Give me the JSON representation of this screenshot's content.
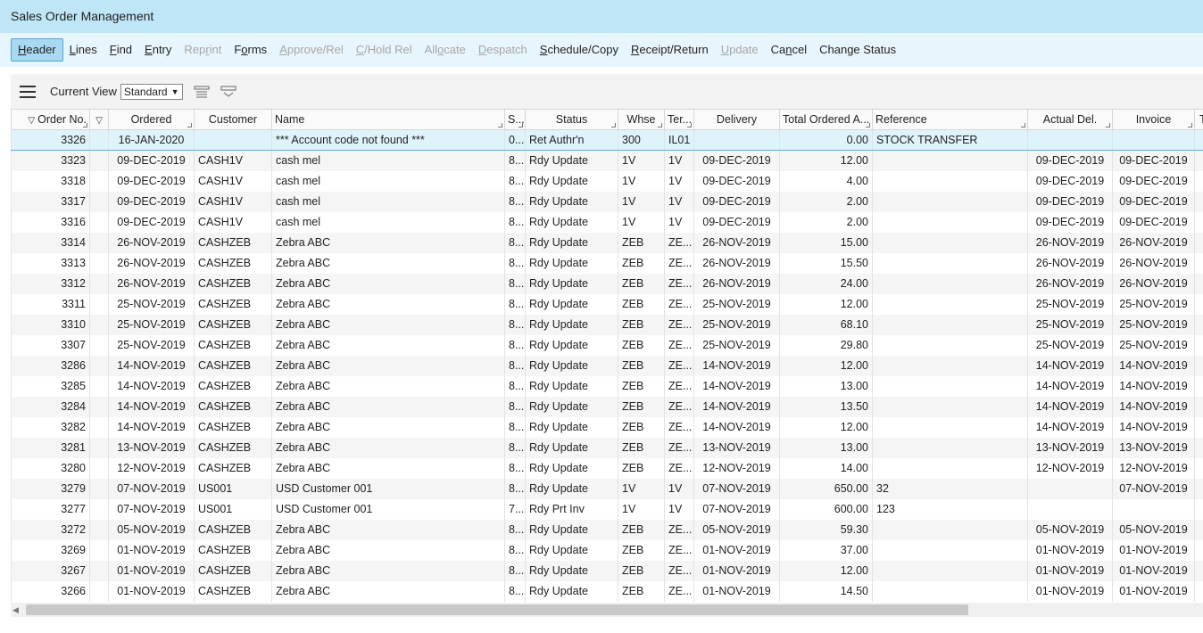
{
  "window": {
    "title": "Sales Order Management"
  },
  "menu": [
    {
      "pre": "",
      "u": "H",
      "post": "eader",
      "state": "active"
    },
    {
      "pre": "",
      "u": "L",
      "post": "ines",
      "state": "enabled"
    },
    {
      "pre": "",
      "u": "F",
      "post": "ind",
      "state": "enabled"
    },
    {
      "pre": "",
      "u": "E",
      "post": "ntry",
      "state": "enabled"
    },
    {
      "pre": "Rep",
      "u": "r",
      "post": "int",
      "state": "disabled"
    },
    {
      "pre": "F",
      "u": "o",
      "post": "rms",
      "state": "enabled"
    },
    {
      "pre": "",
      "u": "A",
      "post": "pprove/Rel",
      "state": "disabled"
    },
    {
      "pre": "",
      "u": "C",
      "post": "/Hold Rel",
      "state": "disabled"
    },
    {
      "pre": "All",
      "u": "o",
      "post": "cate",
      "state": "disabled"
    },
    {
      "pre": "",
      "u": "D",
      "post": "espatch",
      "state": "disabled"
    },
    {
      "pre": "",
      "u": "S",
      "post": "chedule/Copy",
      "state": "enabled"
    },
    {
      "pre": "",
      "u": "R",
      "post": "eceipt/Return",
      "state": "enabled"
    },
    {
      "pre": "",
      "u": "U",
      "post": "pdate",
      "state": "disabled"
    },
    {
      "pre": "Ca",
      "u": "n",
      "post": "cel",
      "state": "enabled"
    },
    {
      "pre": "Change Status",
      "u": "",
      "post": "",
      "state": "enabled"
    }
  ],
  "toolbar": {
    "view_label": "Current View",
    "view_value": "Standard",
    "icons": [
      "menu-icon",
      "filter-rows-icon",
      "collapse-panel-icon"
    ]
  },
  "columns": [
    {
      "label": "Order No.",
      "w": 88
    },
    {
      "label": "",
      "w": 21
    },
    {
      "label": "Ordered",
      "w": 96
    },
    {
      "label": "Customer",
      "w": 87
    },
    {
      "label": "Name",
      "w": 261
    },
    {
      "label": "S...",
      "w": 23
    },
    {
      "label": "Status",
      "w": 104
    },
    {
      "label": "Whse",
      "w": 52
    },
    {
      "label": "Ter...",
      "w": 33
    },
    {
      "label": "Delivery",
      "w": 96
    },
    {
      "label": "Total Ordered A...",
      "w": 104
    },
    {
      "label": "Reference",
      "w": 174
    },
    {
      "label": "Actual Del.",
      "w": 95
    },
    {
      "label": "Invoice",
      "w": 92
    },
    {
      "label": "T",
      "w": 19
    }
  ],
  "rows": [
    [
      "3326",
      "",
      "16-JAN-2020",
      "",
      "*** Account code not found ***",
      "0...",
      "Ret Authr'n",
      "300",
      "IL01",
      "",
      "0.00",
      "STOCK TRANSFER",
      "",
      "",
      ""
    ],
    [
      "3323",
      "",
      "09-DEC-2019",
      "CASH1V",
      "cash mel",
      "8...",
      "Rdy Update",
      "1V",
      "1V",
      "09-DEC-2019",
      "12.00",
      "",
      "09-DEC-2019",
      "09-DEC-2019",
      ""
    ],
    [
      "3318",
      "",
      "09-DEC-2019",
      "CASH1V",
      "cash mel",
      "8...",
      "Rdy Update",
      "1V",
      "1V",
      "09-DEC-2019",
      "4.00",
      "",
      "09-DEC-2019",
      "09-DEC-2019",
      ""
    ],
    [
      "3317",
      "",
      "09-DEC-2019",
      "CASH1V",
      "cash mel",
      "8...",
      "Rdy Update",
      "1V",
      "1V",
      "09-DEC-2019",
      "2.00",
      "",
      "09-DEC-2019",
      "09-DEC-2019",
      ""
    ],
    [
      "3316",
      "",
      "09-DEC-2019",
      "CASH1V",
      "cash mel",
      "8...",
      "Rdy Update",
      "1V",
      "1V",
      "09-DEC-2019",
      "2.00",
      "",
      "09-DEC-2019",
      "09-DEC-2019",
      ""
    ],
    [
      "3314",
      "",
      "26-NOV-2019",
      "CASHZEB",
      "Zebra ABC",
      "8...",
      "Rdy Update",
      "ZEB",
      "ZE...",
      "26-NOV-2019",
      "15.00",
      "",
      "26-NOV-2019",
      "26-NOV-2019",
      ""
    ],
    [
      "3313",
      "",
      "26-NOV-2019",
      "CASHZEB",
      "Zebra ABC",
      "8...",
      "Rdy Update",
      "ZEB",
      "ZE...",
      "26-NOV-2019",
      "15.50",
      "",
      "26-NOV-2019",
      "26-NOV-2019",
      ""
    ],
    [
      "3312",
      "",
      "26-NOV-2019",
      "CASHZEB",
      "Zebra ABC",
      "8...",
      "Rdy Update",
      "ZEB",
      "ZE...",
      "26-NOV-2019",
      "24.00",
      "",
      "26-NOV-2019",
      "26-NOV-2019",
      ""
    ],
    [
      "3311",
      "",
      "25-NOV-2019",
      "CASHZEB",
      "Zebra ABC",
      "8...",
      "Rdy Update",
      "ZEB",
      "ZE...",
      "25-NOV-2019",
      "12.00",
      "",
      "25-NOV-2019",
      "25-NOV-2019",
      ""
    ],
    [
      "3310",
      "",
      "25-NOV-2019",
      "CASHZEB",
      "Zebra ABC",
      "8...",
      "Rdy Update",
      "ZEB",
      "ZE...",
      "25-NOV-2019",
      "68.10",
      "",
      "25-NOV-2019",
      "25-NOV-2019",
      ""
    ],
    [
      "3307",
      "",
      "25-NOV-2019",
      "CASHZEB",
      "Zebra ABC",
      "8...",
      "Rdy Update",
      "ZEB",
      "ZE...",
      "25-NOV-2019",
      "29.80",
      "",
      "25-NOV-2019",
      "25-NOV-2019",
      ""
    ],
    [
      "3286",
      "",
      "14-NOV-2019",
      "CASHZEB",
      "Zebra ABC",
      "8...",
      "Rdy Update",
      "ZEB",
      "ZE...",
      "14-NOV-2019",
      "12.00",
      "",
      "14-NOV-2019",
      "14-NOV-2019",
      ""
    ],
    [
      "3285",
      "",
      "14-NOV-2019",
      "CASHZEB",
      "Zebra ABC",
      "8...",
      "Rdy Update",
      "ZEB",
      "ZE...",
      "14-NOV-2019",
      "13.00",
      "",
      "14-NOV-2019",
      "14-NOV-2019",
      ""
    ],
    [
      "3284",
      "",
      "14-NOV-2019",
      "CASHZEB",
      "Zebra ABC",
      "8...",
      "Rdy Update",
      "ZEB",
      "ZE...",
      "14-NOV-2019",
      "13.50",
      "",
      "14-NOV-2019",
      "14-NOV-2019",
      ""
    ],
    [
      "3282",
      "",
      "14-NOV-2019",
      "CASHZEB",
      "Zebra ABC",
      "8...",
      "Rdy Update",
      "ZEB",
      "ZE...",
      "14-NOV-2019",
      "12.00",
      "",
      "14-NOV-2019",
      "14-NOV-2019",
      ""
    ],
    [
      "3281",
      "",
      "13-NOV-2019",
      "CASHZEB",
      "Zebra ABC",
      "8...",
      "Rdy Update",
      "ZEB",
      "ZE...",
      "13-NOV-2019",
      "13.00",
      "",
      "13-NOV-2019",
      "13-NOV-2019",
      ""
    ],
    [
      "3280",
      "",
      "12-NOV-2019",
      "CASHZEB",
      "Zebra ABC",
      "8...",
      "Rdy Update",
      "ZEB",
      "ZE...",
      "12-NOV-2019",
      "14.00",
      "",
      "12-NOV-2019",
      "12-NOV-2019",
      ""
    ],
    [
      "3279",
      "",
      "07-NOV-2019",
      "US001",
      "USD Customer 001",
      "8...",
      "Rdy Update",
      "1V",
      "1V",
      "07-NOV-2019",
      "650.00",
      "32",
      "",
      "07-NOV-2019",
      ""
    ],
    [
      "3277",
      "",
      "07-NOV-2019",
      "US001",
      "USD Customer 001",
      "7...",
      "Rdy Prt Inv",
      "1V",
      "1V",
      "07-NOV-2019",
      "600.00",
      "123",
      "",
      "",
      ""
    ],
    [
      "3272",
      "",
      "05-NOV-2019",
      "CASHZEB",
      "Zebra ABC",
      "8...",
      "Rdy Update",
      "ZEB",
      "ZE...",
      "05-NOV-2019",
      "59.30",
      "",
      "05-NOV-2019",
      "05-NOV-2019",
      ""
    ],
    [
      "3269",
      "",
      "01-NOV-2019",
      "CASHZEB",
      "Zebra ABC",
      "8...",
      "Rdy Update",
      "ZEB",
      "ZE...",
      "01-NOV-2019",
      "37.00",
      "",
      "01-NOV-2019",
      "01-NOV-2019",
      ""
    ],
    [
      "3267",
      "",
      "01-NOV-2019",
      "CASHZEB",
      "Zebra ABC",
      "8...",
      "Rdy Update",
      "ZEB",
      "ZE...",
      "01-NOV-2019",
      "12.00",
      "",
      "01-NOV-2019",
      "01-NOV-2019",
      ""
    ],
    [
      "3266",
      "",
      "01-NOV-2019",
      "CASHZEB",
      "Zebra ABC",
      "8...",
      "Rdy Update",
      "ZEB",
      "ZE...",
      "01-NOV-2019",
      "14.50",
      "",
      "01-NOV-2019",
      "01-NOV-2019",
      ""
    ]
  ],
  "colors": {
    "title_bg": "#bfe6f6",
    "menu_bg": "#e7f6fc",
    "selected_row": "#dff3fb",
    "accent": "#4fb5e0"
  }
}
